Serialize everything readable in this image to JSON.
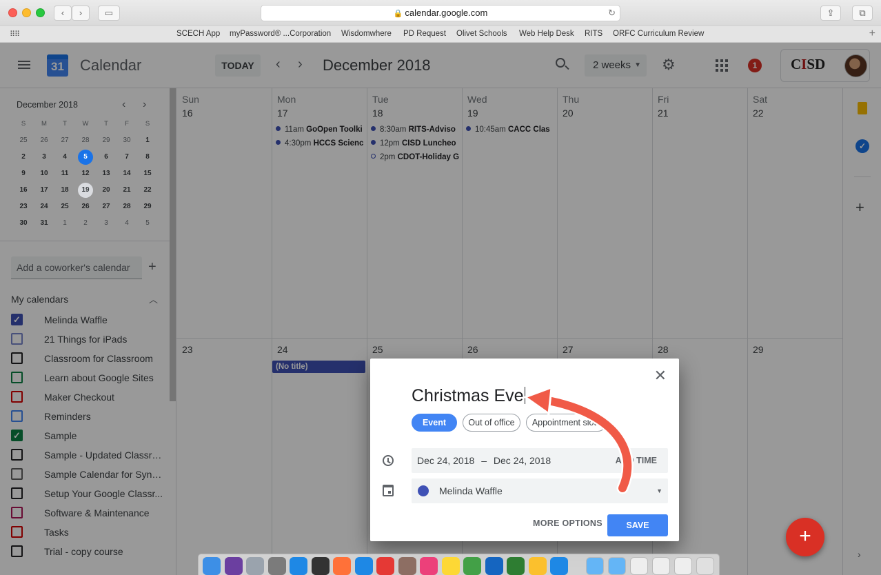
{
  "browser": {
    "url": "calendar.google.com",
    "bookmarks": [
      "SCECH App",
      "myPassword® ...Corporation",
      "Wisdomwhere",
      "PD Request",
      "Olivet Schools",
      "Web Help Desk",
      "RITS",
      "ORFC Curriculum Review"
    ]
  },
  "header": {
    "logo_day": "31",
    "app_title": "Calendar",
    "today_label": "TODAY",
    "month_title": "December 2018",
    "view_label": "2 weeks",
    "notification_count": "1",
    "org_logo_text": "CISD"
  },
  "mini_calendar": {
    "title": "December 2018",
    "weekdays": [
      "S",
      "M",
      "T",
      "W",
      "T",
      "F",
      "S"
    ],
    "weeks": [
      [
        "25",
        "26",
        "27",
        "28",
        "29",
        "30",
        "1"
      ],
      [
        "2",
        "3",
        "4",
        "5",
        "6",
        "7",
        "8"
      ],
      [
        "9",
        "10",
        "11",
        "12",
        "13",
        "14",
        "15"
      ],
      [
        "16",
        "17",
        "18",
        "19",
        "20",
        "21",
        "22"
      ],
      [
        "23",
        "24",
        "25",
        "26",
        "27",
        "28",
        "29"
      ],
      [
        "30",
        "31",
        "1",
        "2",
        "3",
        "4",
        "5"
      ]
    ]
  },
  "sidebar": {
    "coworker_placeholder": "Add a coworker's calendar",
    "my_calendars_label": "My calendars",
    "calendars": [
      {
        "name": "Melinda Waffle",
        "color": "#3f51b5",
        "checked": true
      },
      {
        "name": "21 Things for iPads",
        "color": "#7986cb",
        "checked": false
      },
      {
        "name": "Classroom for Classroom",
        "color": "#202124",
        "checked": false
      },
      {
        "name": "Learn about Google Sites",
        "color": "#0b8043",
        "checked": false
      },
      {
        "name": "Maker Checkout",
        "color": "#d50000",
        "checked": false
      },
      {
        "name": "Reminders",
        "color": "#4285f4",
        "checked": false
      },
      {
        "name": "Sample",
        "color": "#0b8043",
        "checked": true
      },
      {
        "name": "Sample - Updated Classroo...",
        "color": "#202124",
        "checked": false
      },
      {
        "name": "Sample Calendar for Synci...",
        "color": "#616161",
        "checked": false
      },
      {
        "name": "Setup Your Google Classr...",
        "color": "#202124",
        "checked": false
      },
      {
        "name": "Software & Maintenance",
        "color": "#ad1457",
        "checked": false
      },
      {
        "name": "Tasks",
        "color": "#d50000",
        "checked": false
      },
      {
        "name": "Trial - copy course",
        "color": "#202124",
        "checked": false
      }
    ]
  },
  "week1": [
    {
      "day": "Sun",
      "date": "16",
      "events": []
    },
    {
      "day": "Mon",
      "date": "17",
      "events": [
        {
          "time": "11am",
          "title": "GoOpen Toolki",
          "hollow": false
        },
        {
          "time": "4:30pm",
          "title": "HCCS Scienc",
          "hollow": false
        }
      ]
    },
    {
      "day": "Tue",
      "date": "18",
      "events": [
        {
          "time": "8:30am",
          "title": "RITS-Adviso",
          "hollow": false
        },
        {
          "time": "12pm",
          "title": "CISD Luncheo",
          "hollow": false
        },
        {
          "time": "2pm",
          "title": "CDOT-Holiday G",
          "hollow": true
        }
      ]
    },
    {
      "day": "Wed",
      "date": "19",
      "events": [
        {
          "time": "10:45am",
          "title": "CACC Clas",
          "hollow": false
        }
      ]
    },
    {
      "day": "Thu",
      "date": "20",
      "events": []
    },
    {
      "day": "Fri",
      "date": "21",
      "events": []
    },
    {
      "day": "Sat",
      "date": "22",
      "events": []
    }
  ],
  "week2_dates": [
    "23",
    "24",
    "25",
    "26",
    "27",
    "28",
    "29"
  ],
  "draft_chip": "(No title)",
  "dialog": {
    "title_value": "Christmas Eve",
    "type_event": "Event",
    "type_ooo": "Out of office",
    "type_appointment": "Appointment slots",
    "start_date": "Dec 24, 2018",
    "dash": "–",
    "end_date": "Dec 24, 2018",
    "add_time": "ADD TIME",
    "calendar_name": "Melinda Waffle",
    "calendar_color": "#3f51b5",
    "more_options": "MORE OPTIONS",
    "save": "SAVE"
  },
  "fab_label": "+"
}
